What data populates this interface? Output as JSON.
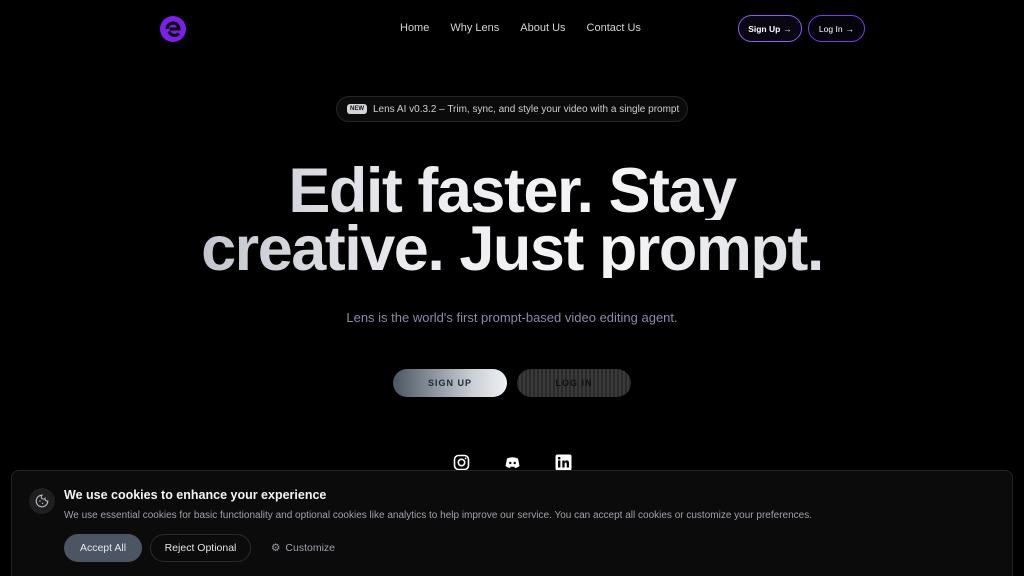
{
  "nav": {
    "logo_icon": "lens-logo-icon",
    "links": [
      "Home",
      "Why Lens",
      "About Us",
      "Contact Us"
    ],
    "signup_label": "Sign Up",
    "login_label": "Log In"
  },
  "announcement": {
    "badge": "NEW",
    "text": "Lens AI v0.3.2 – Trim, sync, and style your video with a single prompt"
  },
  "hero": {
    "headline_line1": "Edit faster. Stay",
    "headline_line2": "creative. Just prompt.",
    "subtitle": "Lens is the world's first prompt-based video editing agent.",
    "signup_cta": "SIGN UP",
    "login_cta": "LOG IN"
  },
  "socials": [
    "instagram-icon",
    "discord-icon",
    "linkedin-icon"
  ],
  "cookie": {
    "title": "We use cookies to enhance your experience",
    "text": "We use essential cookies for basic functionality and optional cookies like analytics to help improve our service. You can accept all cookies or customize your preferences.",
    "accept_label": "Accept All",
    "reject_label": "Reject Optional",
    "customize_label": "Customize"
  },
  "colors": {
    "accent": "#7c3aed",
    "background": "#000000"
  }
}
